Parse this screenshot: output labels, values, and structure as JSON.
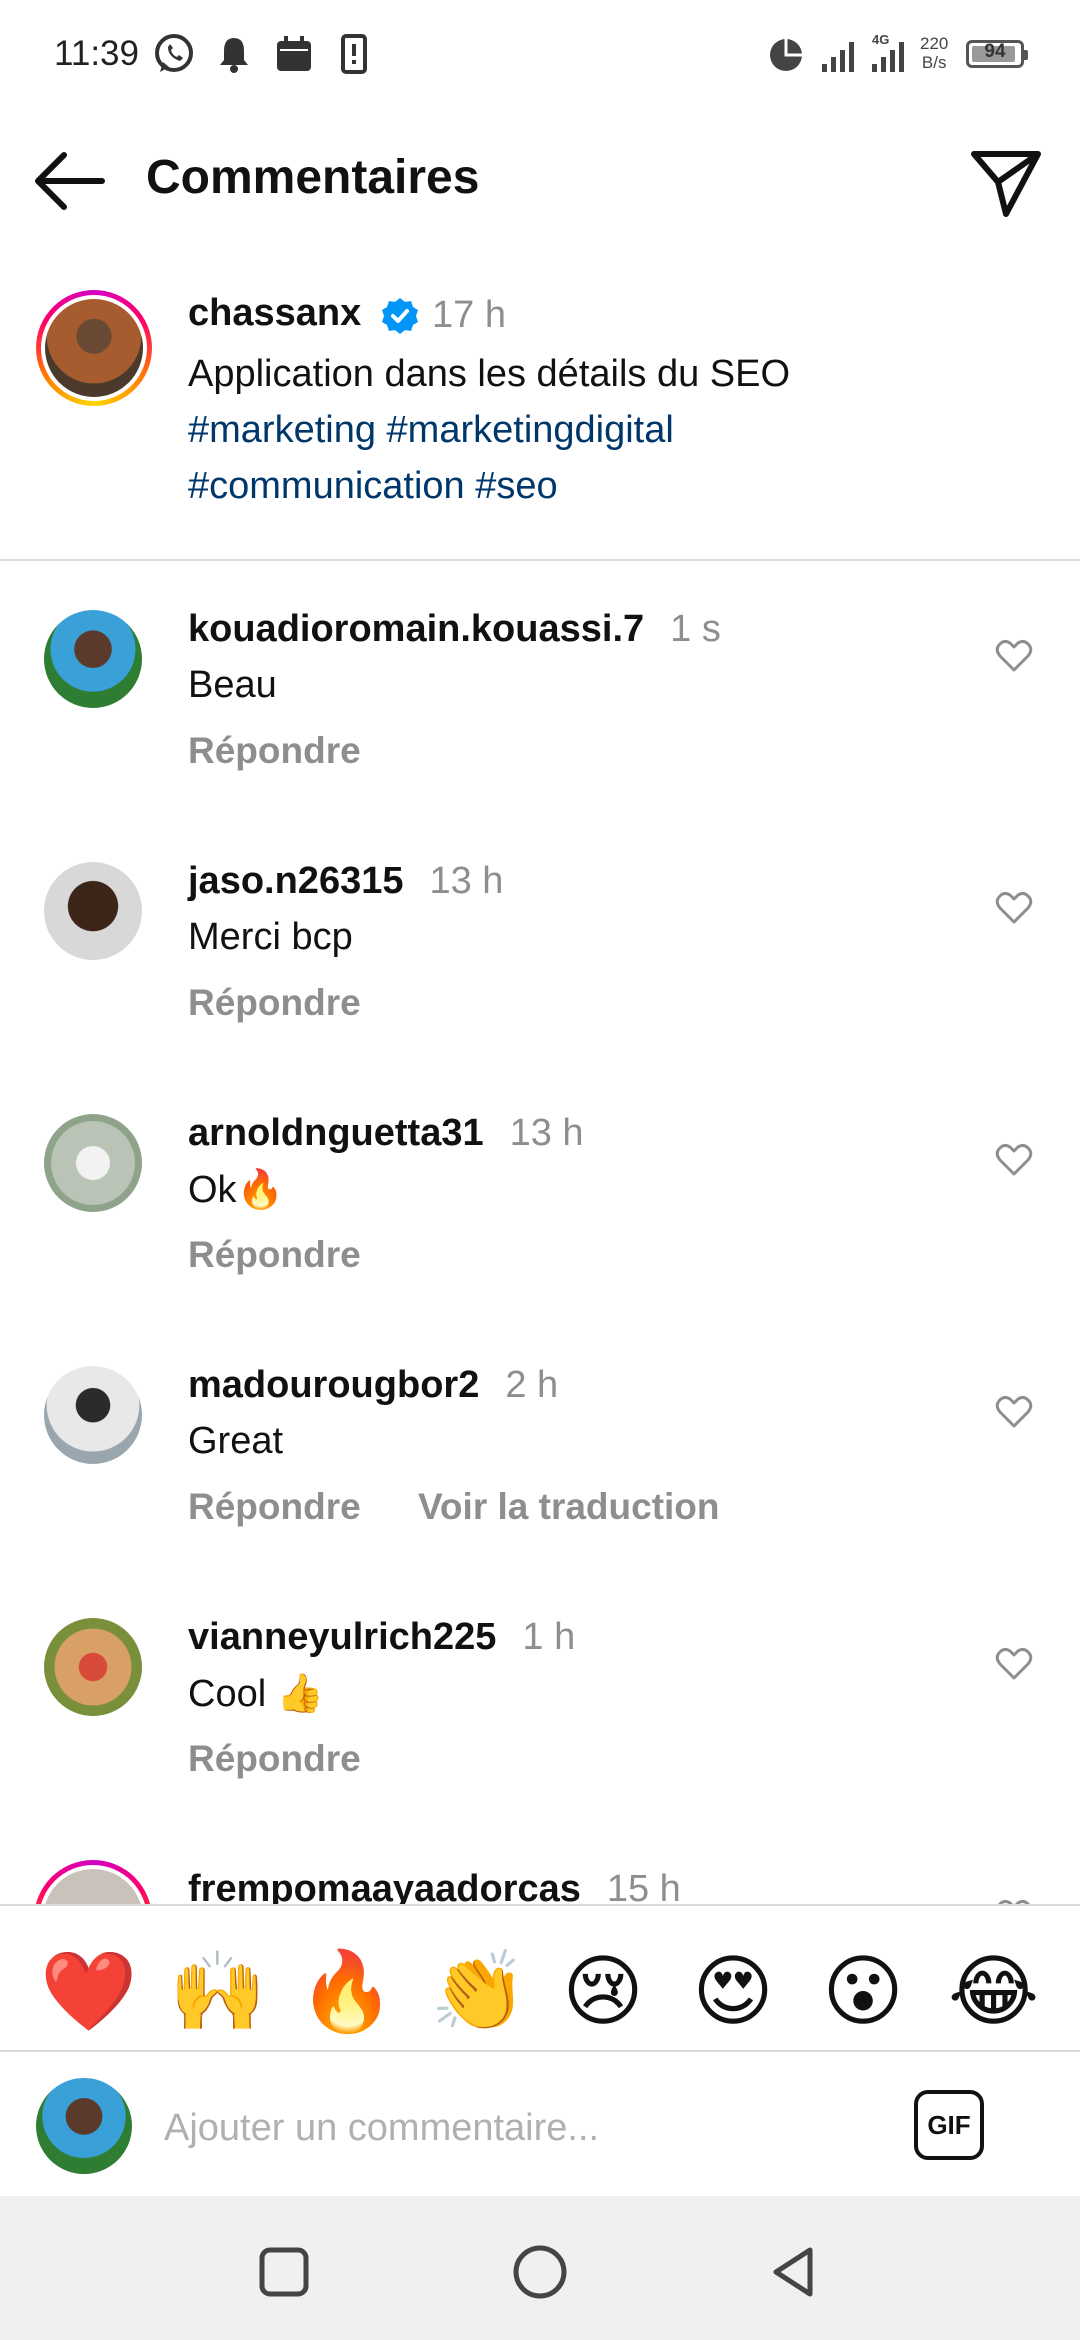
{
  "status_bar": {
    "time": "11:39",
    "network": "4G",
    "net_speed_value": "220",
    "net_speed_unit": "B/s",
    "battery_level": "94",
    "icons": [
      "whatsapp-icon",
      "bell-icon",
      "calendar-icon",
      "phone-storage-icon",
      "data-saver-icon",
      "signal-icon",
      "signal-4g-icon"
    ]
  },
  "header": {
    "title": "Commentaires",
    "back_icon": "arrow-left-icon",
    "share_icon": "paper-plane-icon"
  },
  "post": {
    "username": "chassanx",
    "verified": true,
    "time": "17 h",
    "caption": "Application dans les détails du SEO",
    "hashtags": [
      "#marketing",
      "#marketingdigital",
      "#communication",
      "#seo"
    ]
  },
  "comments": [
    {
      "username": "kouadioromain.kouassi.7",
      "time": "1 s",
      "text": "Beau",
      "reply_label": "Répondre"
    },
    {
      "username": "jaso.n26315",
      "time": "13 h",
      "text": "Merci bcp",
      "reply_label": "Répondre"
    },
    {
      "username": "arnoldnguetta31",
      "time": "13 h",
      "text": "Ok🔥",
      "reply_label": "Répondre"
    },
    {
      "username": "madourougbor2",
      "time": "2 h",
      "text": "Great",
      "reply_label": "Répondre",
      "translate_label": "Voir la traduction"
    },
    {
      "username": "vianneyulrich225",
      "time": "1 h",
      "text": "Cool 👍",
      "reply_label": "Répondre"
    },
    {
      "username": "frempomaayaadorcas",
      "time": "15 h",
      "text": "",
      "reply_label": ""
    }
  ],
  "emoji_bar": [
    "❤️",
    "🙌",
    "🔥",
    "👏",
    "😢",
    "😍",
    "😮",
    "😂"
  ],
  "composer": {
    "placeholder": "Ajouter un commentaire...",
    "gif_label": "GIF"
  },
  "colors": {
    "hashtag": "#00376b",
    "secondary_text": "#8e8e8e",
    "verified": "#0095f6",
    "divider": "#dbdbdb"
  }
}
